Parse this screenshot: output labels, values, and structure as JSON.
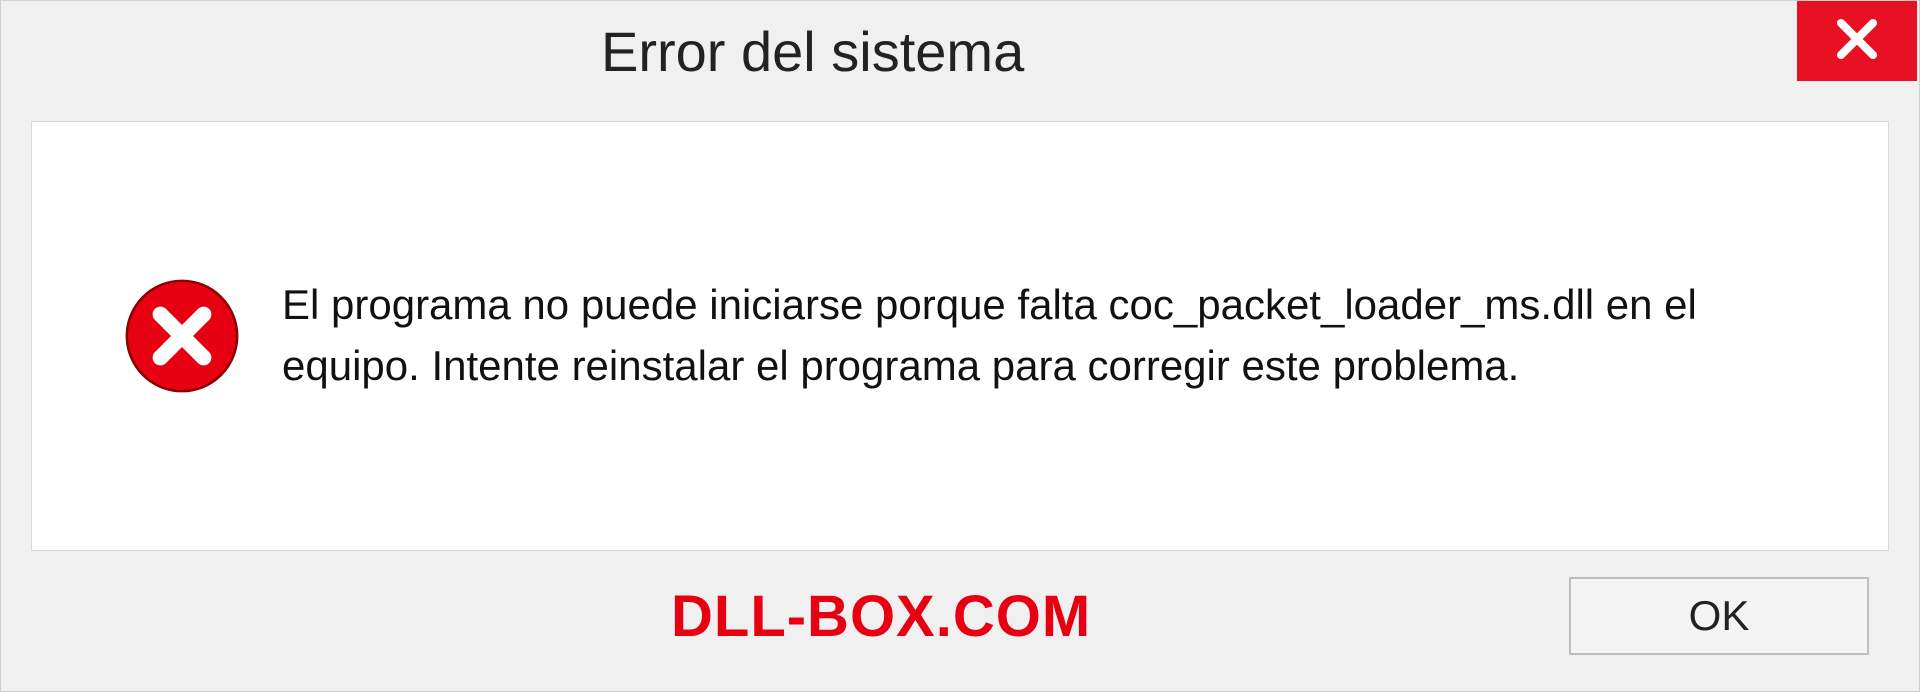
{
  "dialog": {
    "title": "Error del sistema",
    "message": "El programa no puede iniciarse porque falta coc_packet_loader_ms.dll en el equipo. Intente reinstalar el programa para corregir este problema.",
    "ok_label": "OK",
    "watermark": "DLL-BOX.COM",
    "icons": {
      "close": "close-icon",
      "error": "error-circle-x-icon"
    },
    "colors": {
      "close_bg": "#e81123",
      "error_icon": "#e60012",
      "watermark": "#e60012",
      "panel_bg": "#ffffff",
      "dialog_bg": "#f0f0f0"
    }
  }
}
